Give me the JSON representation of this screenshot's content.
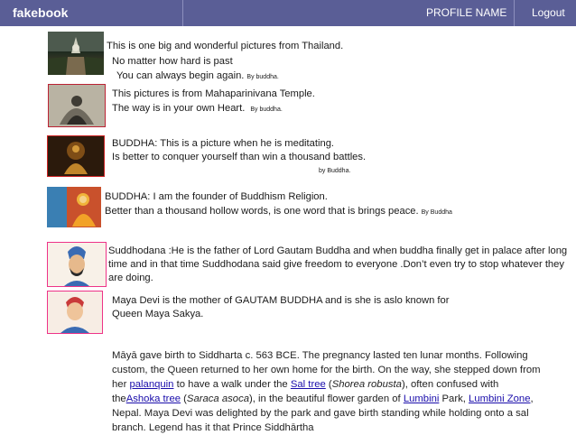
{
  "header": {
    "brand": "fakebook",
    "profile": "PROFILE NAME",
    "logout": "Logout"
  },
  "posts": [
    {
      "lines": [
        "This is one big and  wonderful pictures from Thailand.",
        "No matter how hard is past",
        "You can always begin again."
      ],
      "byline": "By buddha."
    },
    {
      "lines": [
        "This pictures is from Mahaparinivana Temple.",
        "The way is in your own Heart."
      ],
      "byline": "By buddha."
    },
    {
      "lines": [
        "BUDDHA:  This is a picture when he is meditating.",
        "Is better to conquer yourself than win a thousand battles."
      ],
      "byline": "by Buddha."
    },
    {
      "lines": [
        "BUDDHA:  I am the founder of  Buddhism Religion.",
        "Better than a thousand hollow words, is one word that is brings peace."
      ],
      "byline": "By Buddha"
    },
    {
      "lines": [
        "Suddhodana :He is the father of Lord Gautam Buddha and when buddha finally get in palace after long",
        "time and in that time Suddhodana  said give freedom to everyone .Don’t even try to stop whatever they",
        "are doing."
      ]
    },
    {
      "lines": [
        "Maya Devi is the mother of  GAUTAM BUDDHA and is she is aslo known for",
        "Queen Maya Sakya."
      ]
    }
  ],
  "article": {
    "t1": "Māyā gave birth to Siddharta c. 563 BCE. The pregnancy lasted ten lunar months. Following custom, the Queen returned to her own home for the birth. On the way, she stepped down from her ",
    "link1": "palanquin",
    "t2": " to have a walk under the ",
    "link2": "Sal tree",
    "t3": " (",
    "italic1": "Shorea robusta",
    "t4": "), often confused with the",
    "link3": "Ashoka tree",
    "t5": " (",
    "italic2": "Saraca asoca",
    "t6": "), in the beautiful flower garden of ",
    "link4": "Lumbini",
    "t7": " Park, ",
    "link5": "Lumbini Zone",
    "t8": ", Nepal. Maya Devi was delighted by the park and gave birth standing while holding onto a sal branch. Legend has it that Prince Siddhārtha"
  },
  "colors": {
    "topbar": "#5a5e96",
    "link": "#1a0dab"
  }
}
